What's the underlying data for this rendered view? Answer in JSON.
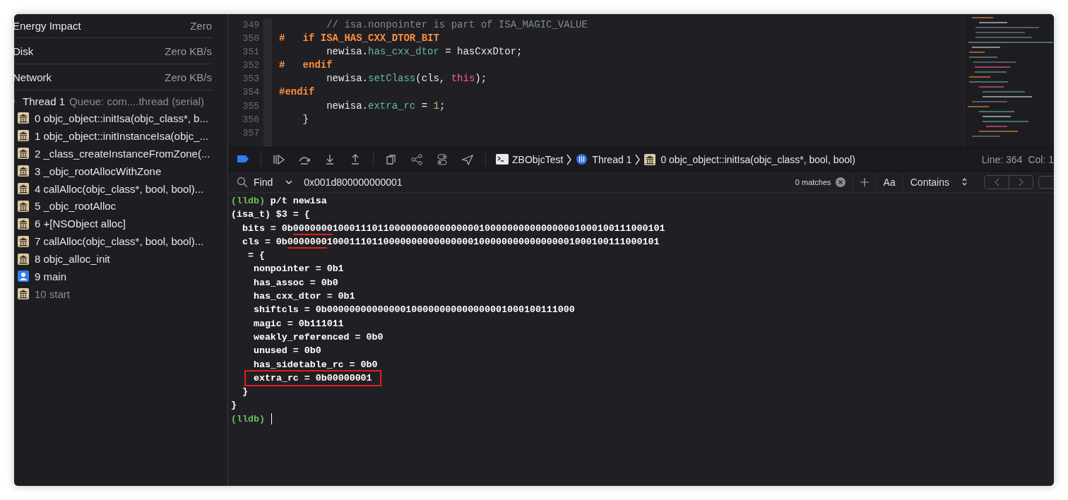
{
  "sidebar": {
    "gauges": [
      {
        "label": "Energy Impact",
        "value": "Zero"
      },
      {
        "label": "Disk",
        "value": "Zero KB/s"
      },
      {
        "label": "Network",
        "value": "Zero KB/s"
      }
    ],
    "thread": {
      "name": "Thread 1",
      "queue": "Queue: com....thread (serial)"
    },
    "frames": [
      {
        "label": "0 objc_object::initIsa(objc_class*, b...",
        "kind": "library",
        "dimmed": false
      },
      {
        "label": "1 objc_object::initInstanceIsa(objc_...",
        "kind": "library",
        "dimmed": false
      },
      {
        "label": "2 _class_createInstanceFromZone(...",
        "kind": "library",
        "dimmed": false
      },
      {
        "label": "3 _objc_rootAllocWithZone",
        "kind": "library",
        "dimmed": false
      },
      {
        "label": "4 callAlloc(objc_class*, bool, bool)...",
        "kind": "library",
        "dimmed": false
      },
      {
        "label": "5 _objc_rootAlloc",
        "kind": "library",
        "dimmed": false
      },
      {
        "label": "6 +[NSObject alloc]",
        "kind": "library",
        "dimmed": false
      },
      {
        "label": "7 callAlloc(objc_class*, bool, bool)...",
        "kind": "library",
        "dimmed": false
      },
      {
        "label": "8 objc_alloc_init",
        "kind": "library",
        "dimmed": false
      },
      {
        "label": "9 main",
        "kind": "user",
        "dimmed": false
      },
      {
        "label": "10 start",
        "kind": "library",
        "dimmed": true
      }
    ]
  },
  "editor": {
    "lines": [
      {
        "number": "349",
        "segments": [
          {
            "text": "        // isa.nonpointer is part of ISA_MAGIC_VALUE",
            "kind": "comment"
          }
        ]
      },
      {
        "number": "350",
        "segments": [
          {
            "text": "#   if ISA_HAS_CXX_DTOR_BIT",
            "kind": "preproc"
          }
        ]
      },
      {
        "number": "351",
        "segments": [
          {
            "text": "        newisa.",
            "kind": "plain"
          },
          {
            "text": "has_cxx_dtor",
            "kind": "member"
          },
          {
            "text": " = hasCxxDtor;",
            "kind": "plain"
          }
        ]
      },
      {
        "number": "352",
        "segments": [
          {
            "text": "#   endif",
            "kind": "preproc"
          }
        ]
      },
      {
        "number": "353",
        "segments": [
          {
            "text": "        newisa.",
            "kind": "plain"
          },
          {
            "text": "setClass",
            "kind": "member"
          },
          {
            "text": "(cls, ",
            "kind": "plain"
          },
          {
            "text": "this",
            "kind": "keyword"
          },
          {
            "text": ");",
            "kind": "plain"
          }
        ]
      },
      {
        "number": "354",
        "segments": [
          {
            "text": "#endif",
            "kind": "preproc"
          }
        ]
      },
      {
        "number": "355",
        "segments": [
          {
            "text": "        newisa.",
            "kind": "plain"
          },
          {
            "text": "extra_rc",
            "kind": "member"
          },
          {
            "text": " = ",
            "kind": "plain"
          },
          {
            "text": "1",
            "kind": "number"
          },
          {
            "text": ";",
            "kind": "plain"
          }
        ]
      },
      {
        "number": "356",
        "segments": [
          {
            "text": "    }",
            "kind": "plain"
          }
        ]
      },
      {
        "number": "357"
      }
    ]
  },
  "debug_bar": {
    "breadcrumbs": [
      {
        "label": "ZBObjcTest",
        "kind": "app"
      },
      {
        "label": "Thread 1",
        "kind": "thread"
      },
      {
        "label": "0 objc_object::initIsa(objc_class*, bool, bool)",
        "kind": "frame"
      }
    ],
    "line": "Line: 364",
    "column": "Col: 1"
  },
  "find_bar": {
    "mode": "Find",
    "query": "0x001d800000000001",
    "matches": "0 matches",
    "case_button": "Aa",
    "match_type": "Contains"
  },
  "console": {
    "lines": [
      {
        "segments": [
          {
            "text": "(lldb) ",
            "kind": "prompt"
          },
          {
            "text": "p/t newisa",
            "kind": "output"
          }
        ]
      },
      {
        "segments": [
          {
            "text": "(isa_t) $3 = {",
            "kind": "output"
          }
        ]
      },
      {
        "segments": [
          {
            "text": "  bits = 0b",
            "kind": "output"
          },
          {
            "text": "0000000",
            "kind": "underlined"
          },
          {
            "text": "10001110110000000000000000100000000000000001000100111000101",
            "kind": "output"
          }
        ]
      },
      {
        "segments": [
          {
            "text": "  cls = 0b",
            "kind": "output"
          },
          {
            "text": "0000000",
            "kind": "underlined"
          },
          {
            "text": "10001110110000000000000000100000000000000001000100111000101",
            "kind": "output"
          }
        ]
      },
      {
        "segments": [
          {
            "text": "   = {",
            "kind": "output"
          }
        ]
      },
      {
        "segments": [
          {
            "text": "    nonpointer = 0b1",
            "kind": "output"
          }
        ]
      },
      {
        "segments": [
          {
            "text": "    has_assoc = 0b0",
            "kind": "output"
          }
        ]
      },
      {
        "segments": [
          {
            "text": "    has_cxx_dtor = 0b1",
            "kind": "output"
          }
        ]
      },
      {
        "segments": [
          {
            "text": "    shiftcls = 0b00000000000000100000000000000001000100111000",
            "kind": "output"
          }
        ]
      },
      {
        "segments": [
          {
            "text": "    magic = 0b111011",
            "kind": "output"
          }
        ]
      },
      {
        "segments": [
          {
            "text": "    weakly_referenced = 0b0",
            "kind": "output"
          }
        ]
      },
      {
        "segments": [
          {
            "text": "    unused = 0b0",
            "kind": "output"
          }
        ]
      },
      {
        "segments": [
          {
            "text": "    has_sidetable_rc = 0b0",
            "kind": "output"
          }
        ]
      },
      {
        "segments": [
          {
            "text": "extra_rc = 0b00000001",
            "kind": "boxed"
          }
        ]
      },
      {
        "segments": [
          {
            "text": "  }",
            "kind": "output"
          }
        ]
      },
      {
        "segments": [
          {
            "text": "}",
            "kind": "output"
          }
        ]
      },
      {
        "segments": [
          {
            "text": "(lldb) ",
            "kind": "prompt"
          }
        ],
        "cursor": true
      }
    ]
  }
}
